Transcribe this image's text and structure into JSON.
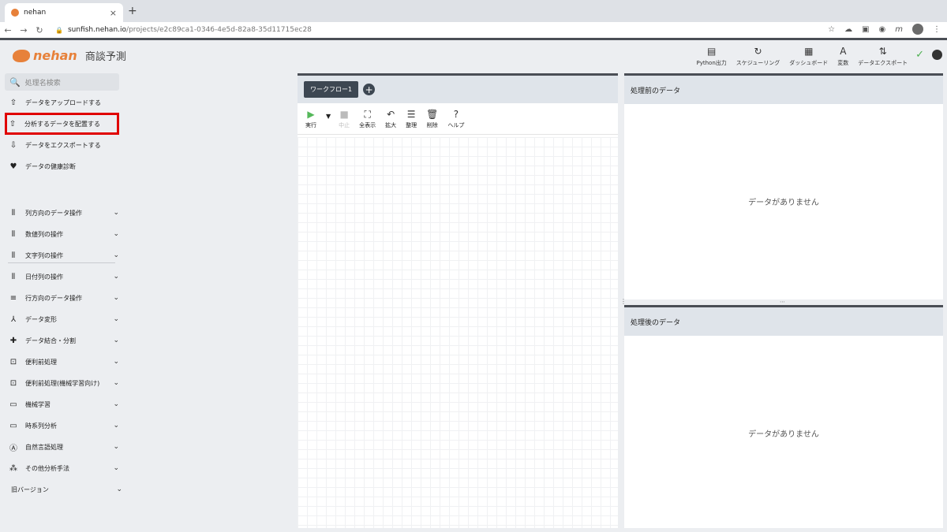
{
  "browser": {
    "tab_title": "nehan",
    "tab_close": "×",
    "new_tab": "+",
    "url_host": "sunfish.nehan.io",
    "url_path": "/projects/e2c89ca1-0346-4e5d-82a8-35d11715ec28",
    "nav": {
      "back": "←",
      "forward": "→",
      "reload": "↻"
    }
  },
  "app": {
    "brand": "nehan",
    "project_name": "商談予測",
    "accent": "#e7813a"
  },
  "topnav": [
    {
      "icon": "file-icon",
      "glyph": "▤",
      "label": "Python出力"
    },
    {
      "icon": "schedule-icon",
      "glyph": "↻",
      "label": "スケジューリング"
    },
    {
      "icon": "dashboard-icon",
      "glyph": "▦",
      "label": "ダッシュボード"
    },
    {
      "icon": "variable-icon",
      "glyph": "A",
      "label": "変数"
    },
    {
      "icon": "export-icon",
      "glyph": "⇅",
      "label": "データエクスポート"
    }
  ],
  "status": {
    "saved_glyph": "✓"
  },
  "sidebar": {
    "search_placeholder": "処理名検索",
    "primary": [
      {
        "icon": "upload-icon",
        "glyph": "⇧",
        "label": "データをアップロードする"
      },
      {
        "icon": "place-data-icon",
        "glyph": "⇧",
        "label": "分析するデータを配置する"
      },
      {
        "icon": "export-icon",
        "glyph": "⇩",
        "label": "データをエクスポートする"
      },
      {
        "icon": "heart-icon",
        "glyph": "♥",
        "label": "データの健康診断"
      }
    ],
    "categories": [
      {
        "icon": "columns-icon",
        "glyph": "⦀",
        "label": "列方向のデータ操作"
      },
      {
        "icon": "columns-icon",
        "glyph": "⦀",
        "label": "数値列の操作"
      },
      {
        "icon": "columns-icon",
        "glyph": "⦀",
        "label": "文字列の操作"
      },
      {
        "icon": "columns-icon",
        "glyph": "⦀",
        "label": "日付列の操作"
      },
      {
        "icon": "rows-icon",
        "glyph": "≡",
        "label": "行方向のデータ操作"
      },
      {
        "icon": "transform-icon",
        "glyph": "⅄",
        "label": "データ変形"
      },
      {
        "icon": "puzzle-icon",
        "glyph": "✚",
        "label": "データ結合・分割"
      },
      {
        "icon": "preprocess-icon",
        "glyph": "⊡",
        "label": "便利前処理"
      },
      {
        "icon": "preprocess-icon",
        "glyph": "⊡",
        "label": "便利前処理(機械学習向け)"
      },
      {
        "icon": "ml-icon",
        "glyph": "▭",
        "label": "機械学習"
      },
      {
        "icon": "timeseries-icon",
        "glyph": "▭",
        "label": "時系列分析"
      },
      {
        "icon": "nlp-icon",
        "glyph": "Ⓐ",
        "label": "自然言語処理"
      },
      {
        "icon": "other-analysis-icon",
        "glyph": "⁂",
        "label": "その他分析手法"
      },
      {
        "icon": "",
        "glyph": "",
        "label": "旧バージョン"
      }
    ],
    "chevron": "⌄"
  },
  "workflow": {
    "tab_label": "ワークフロー1",
    "add_glyph": "+",
    "tools": [
      {
        "name": "run",
        "glyph": "▶",
        "label": "実行",
        "disabled": false
      },
      {
        "name": "stop",
        "glyph": "■",
        "label": "中止",
        "disabled": true
      },
      {
        "name": "fit",
        "glyph": "⛶",
        "label": "全表示",
        "disabled": false
      },
      {
        "name": "zoom",
        "glyph": "↶",
        "label": "拡大",
        "disabled": false
      },
      {
        "name": "arrange",
        "glyph": "☰",
        "label": "整理",
        "disabled": false
      },
      {
        "name": "delete",
        "glyph": "🗑",
        "label": "削除",
        "disabled": false
      },
      {
        "name": "help",
        "glyph": "?",
        "label": "ヘルプ",
        "disabled": false
      }
    ],
    "run_caret": "▼"
  },
  "panels": {
    "before_title": "処理前のデータ",
    "after_title": "処理後のデータ",
    "empty_message": "データがありません"
  }
}
